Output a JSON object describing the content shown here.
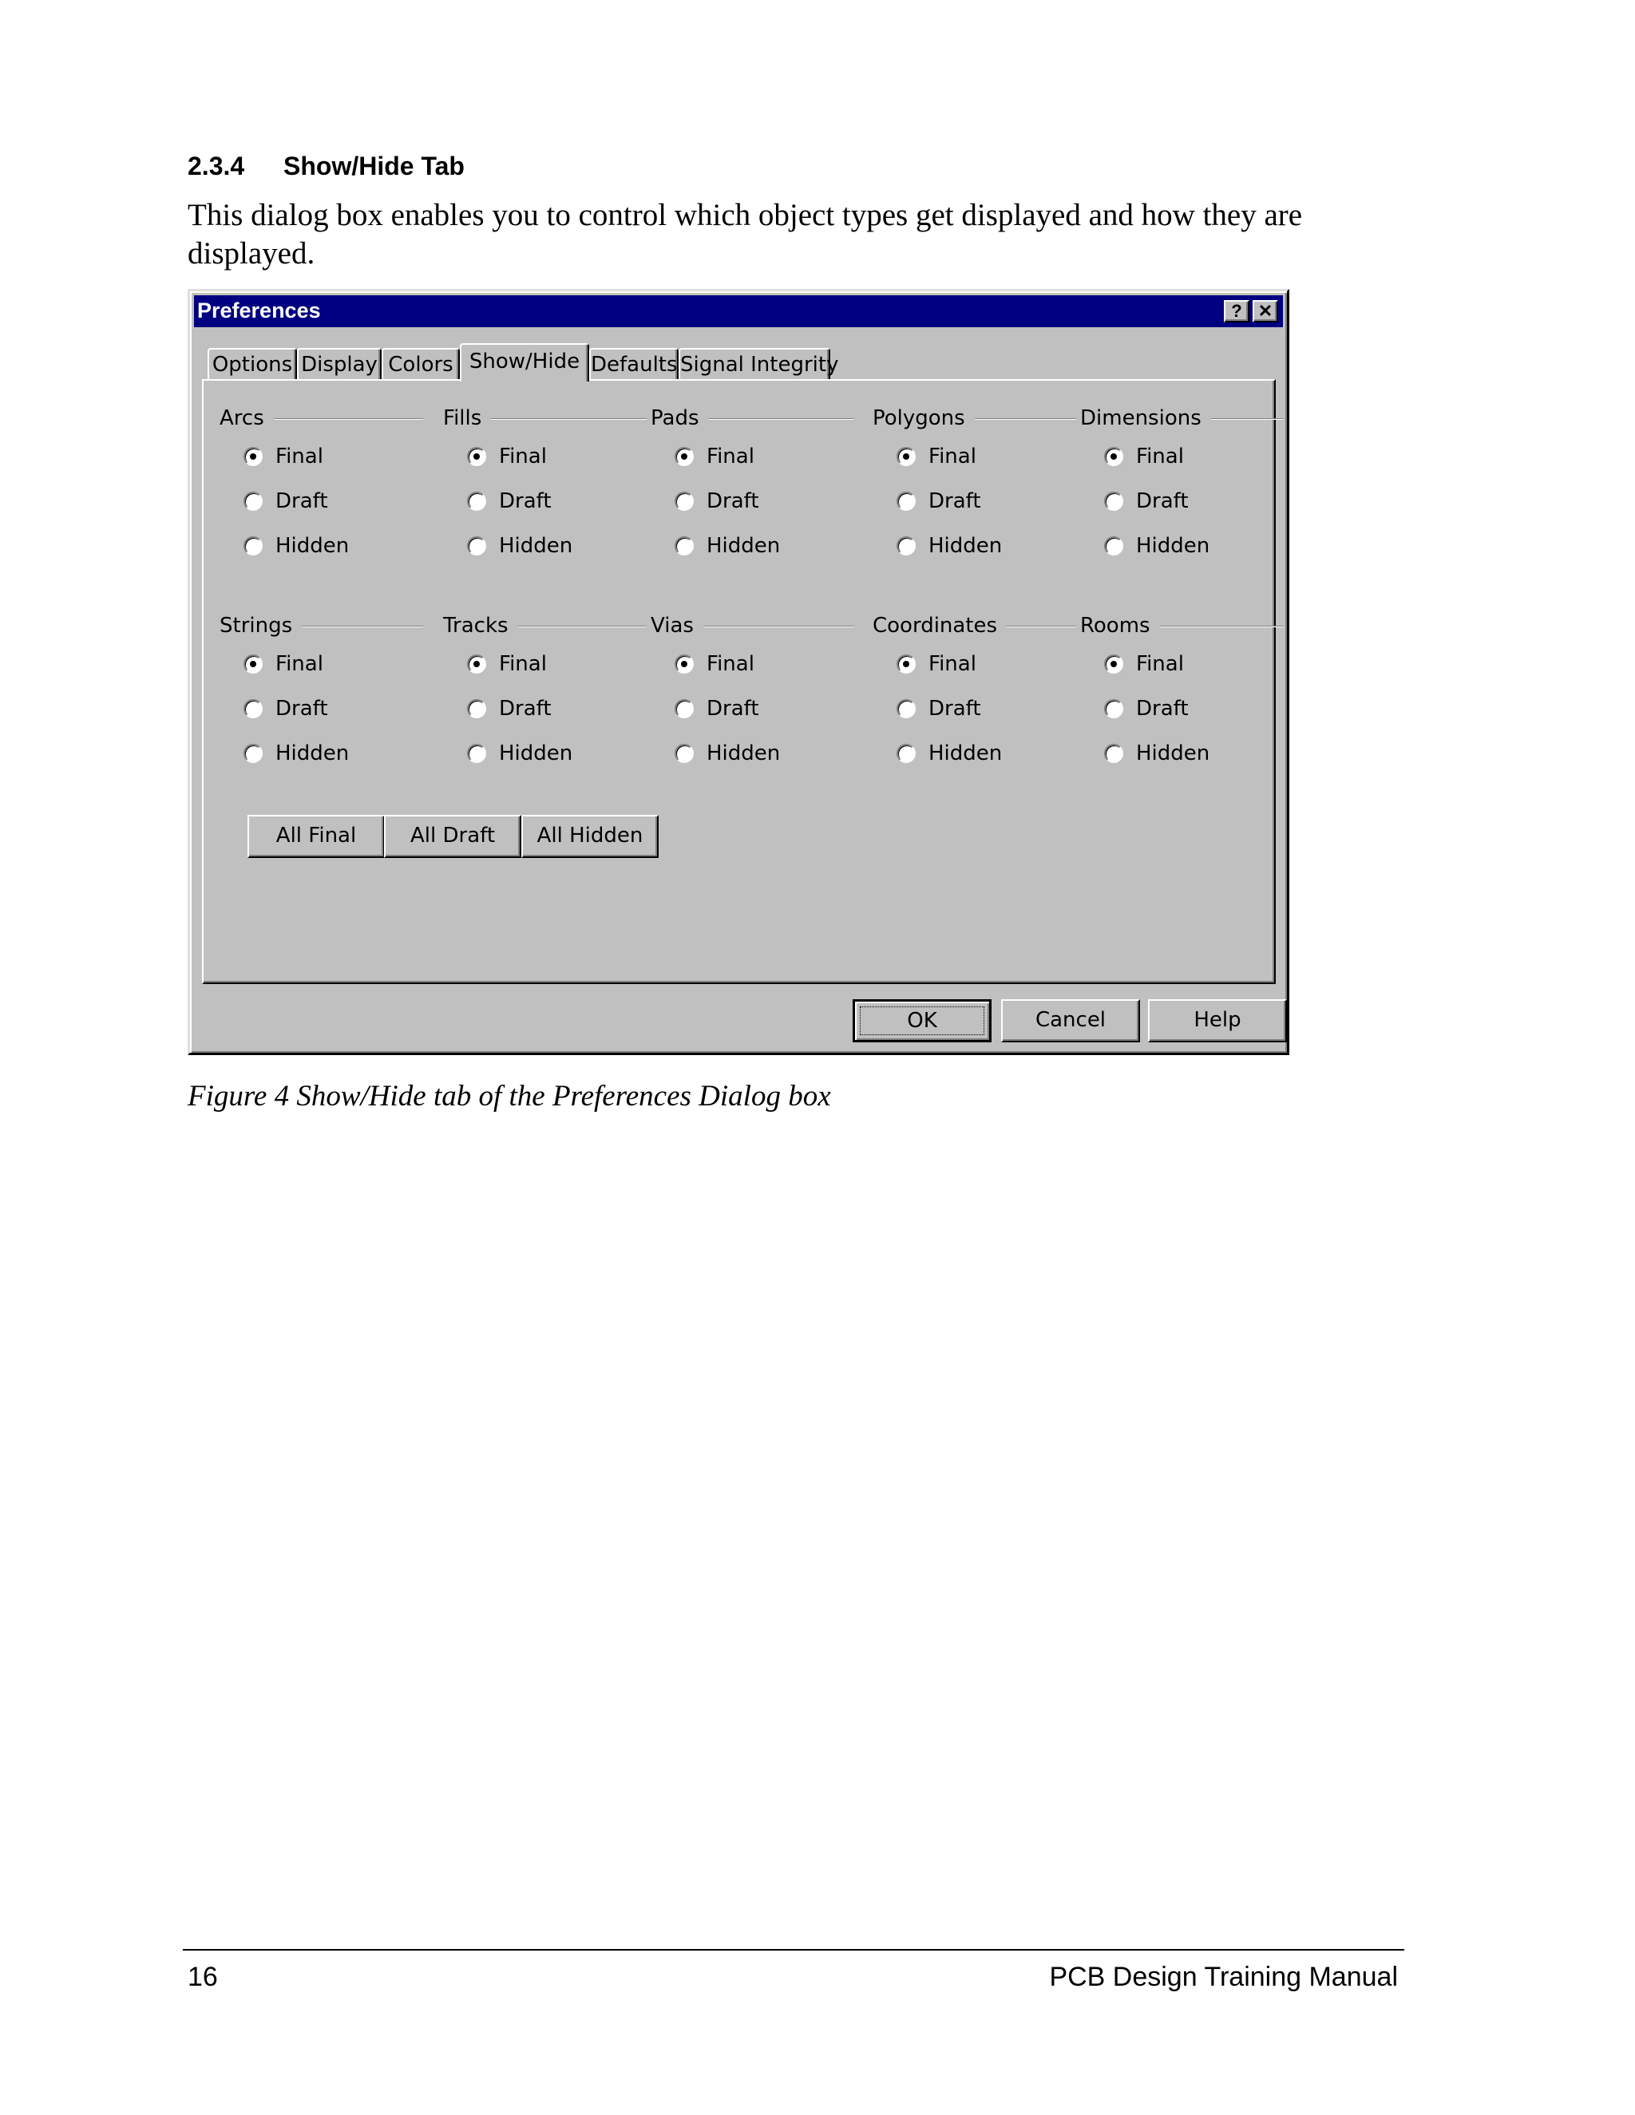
{
  "section": {
    "number": "2.3.4",
    "title": "Show/Hide Tab"
  },
  "paragraph": "This dialog box enables you to control which object types get displayed and how they are displayed.",
  "dialog": {
    "title": "Preferences",
    "help_glyph": "?",
    "close_glyph": "✕",
    "tabs": [
      "Options",
      "Display",
      "Colors",
      "Show/Hide",
      "Defaults",
      "Signal Integrity"
    ],
    "active_tab": "Show/Hide",
    "groups": [
      {
        "label": "Arcs",
        "selected": "Final"
      },
      {
        "label": "Fills",
        "selected": "Final"
      },
      {
        "label": "Pads",
        "selected": "Final"
      },
      {
        "label": "Polygons",
        "selected": "Final"
      },
      {
        "label": "Dimensions",
        "selected": "Final"
      },
      {
        "label": "Strings",
        "selected": "Final"
      },
      {
        "label": "Tracks",
        "selected": "Final"
      },
      {
        "label": "Vias",
        "selected": "Final"
      },
      {
        "label": "Coordinates",
        "selected": "Final"
      },
      {
        "label": "Rooms",
        "selected": "Final"
      }
    ],
    "options": [
      "Final",
      "Draft",
      "Hidden"
    ],
    "all_buttons": [
      "All Final",
      "All Draft",
      "All Hidden"
    ],
    "ok_label": "OK",
    "cancel_label": "Cancel",
    "help_label": "Help"
  },
  "caption": "Figure 4 Show/Hide tab of the Preferences Dialog box",
  "footer": {
    "page_number": "16",
    "manual_title": "PCB Design Training Manual"
  }
}
